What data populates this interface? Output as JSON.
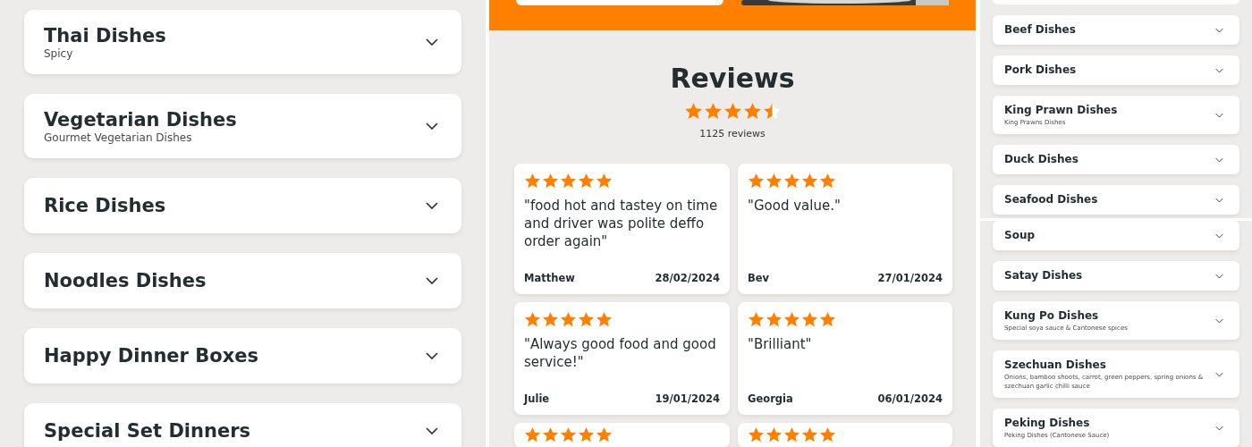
{
  "menu_left": {
    "categories": [
      {
        "title": "Thai Dishes",
        "description": "Spicy"
      },
      {
        "title": "Vegetarian Dishes",
        "description": "Gourmet Vegetarian Dishes"
      },
      {
        "title": "Rice Dishes"
      },
      {
        "title": "Noodles Dishes"
      },
      {
        "title": "Happy Dinner Boxes"
      },
      {
        "title": "Special Set Dinners"
      }
    ]
  },
  "reviews": {
    "title": "Reviews",
    "stars": 4.5,
    "count": "1125 reviews",
    "items": [
      {
        "stars": 5,
        "text": "\"food hot and tastey on time and driver was polite deffo order again\"",
        "author": "Matthew",
        "date": "28/02/2024"
      },
      {
        "stars": 5,
        "text": "\"Good value.\"",
        "author": "Bev",
        "date": "27/01/2024"
      },
      {
        "stars": 5,
        "text": "\"Always good food and good service!\"",
        "author": "Julie",
        "date": "19/01/2024"
      },
      {
        "stars": 5,
        "text": "\"Brilliant\"",
        "author": "Georgia",
        "date": "06/01/2024"
      },
      {
        "stars": 5
      },
      {
        "stars": 5
      }
    ]
  },
  "menu_right": {
    "groups": [
      [
        {
          "title": "Beef Dishes"
        },
        {
          "title": "Pork Dishes"
        },
        {
          "title": "King Prawn Dishes",
          "description": "King Prawns Dishes"
        },
        {
          "title": "Duck Dishes"
        },
        {
          "title": "Seafood Dishes"
        }
      ],
      [
        {
          "title": "Soup"
        },
        {
          "title": "Satay Dishes"
        },
        {
          "title": "Kung Po Dishes",
          "description": "Special soya sauce & Cantonese spices"
        },
        {
          "title": "Szechuan Dishes",
          "description": "Onions, bamboo shoots, carrot, green peppers, spring onions & szechuan garlic chilli sauce"
        },
        {
          "title": "Peking Dishes",
          "description": "Peking Dishes (Cantonese Sauce)"
        }
      ]
    ]
  }
}
